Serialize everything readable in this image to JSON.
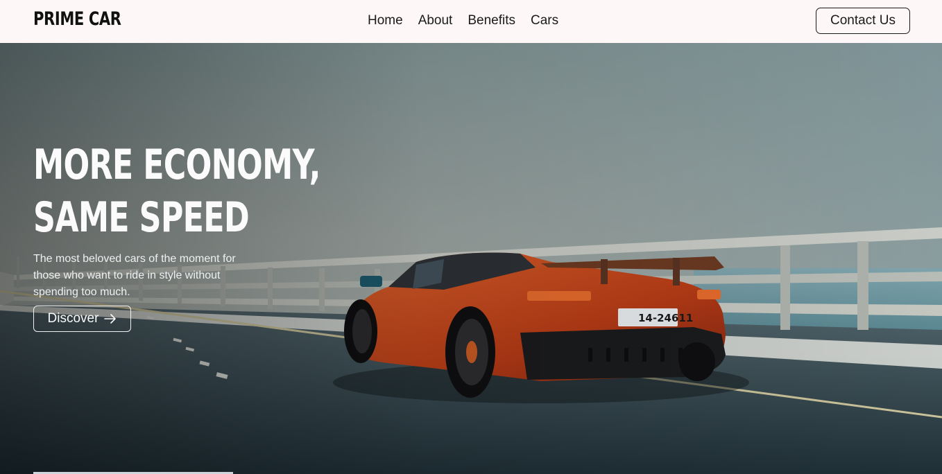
{
  "nav": {
    "brand": "PRIME CAR",
    "links": [
      "Home",
      "About",
      "Benefits",
      "Cars"
    ],
    "contact_label": "Contact Us"
  },
  "hero": {
    "title_line1": "MORE ECONOMY,",
    "title_line2": "SAME SPEED",
    "subtitle": "The most beloved cars of the moment for those who want to ride in style without spending too much.",
    "cta_label": "Discover",
    "cta_icon": "arrow-right-icon",
    "license_plate": "14-24611"
  },
  "colors": {
    "navbar_bg": "#fdf8f7",
    "car_body": "#c2451b",
    "sky": "#9aa7a6",
    "sea": "#5f8a95"
  }
}
